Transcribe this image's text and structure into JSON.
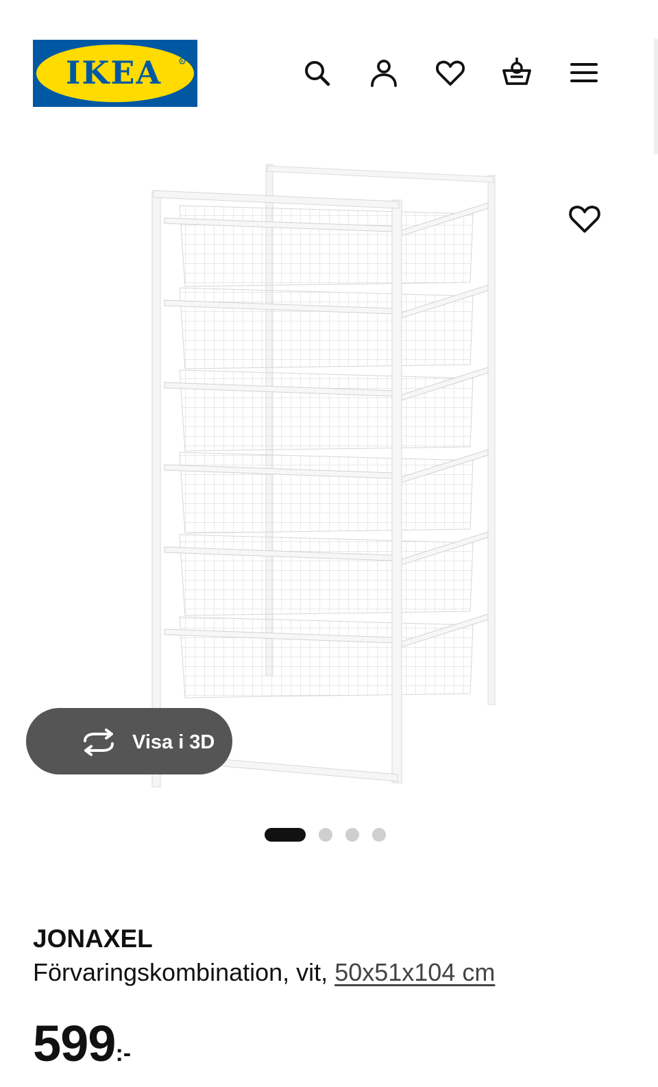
{
  "header": {
    "logo_text": "IKEA",
    "brand_colors": {
      "blue": "#0058a3",
      "yellow": "#ffdb00"
    },
    "icons": [
      "search-icon",
      "profile-icon",
      "heart-icon",
      "basket-icon",
      "menu-icon"
    ]
  },
  "gallery": {
    "view3d_label": "Visa i 3D",
    "view3d_icon": "rotate-icon",
    "favorite_icon": "heart-icon",
    "dot_count": 4,
    "active_dot": 1
  },
  "product": {
    "name": "JONAXEL",
    "description": "Förvaringskombination, vit, ",
    "size": "50x51x104 cm",
    "price": "599",
    "price_suffix": ":-"
  },
  "colors": {
    "view3d_bg": "#555555",
    "dot_active": "#111111",
    "dot_inactive": "#cfcfcf"
  }
}
